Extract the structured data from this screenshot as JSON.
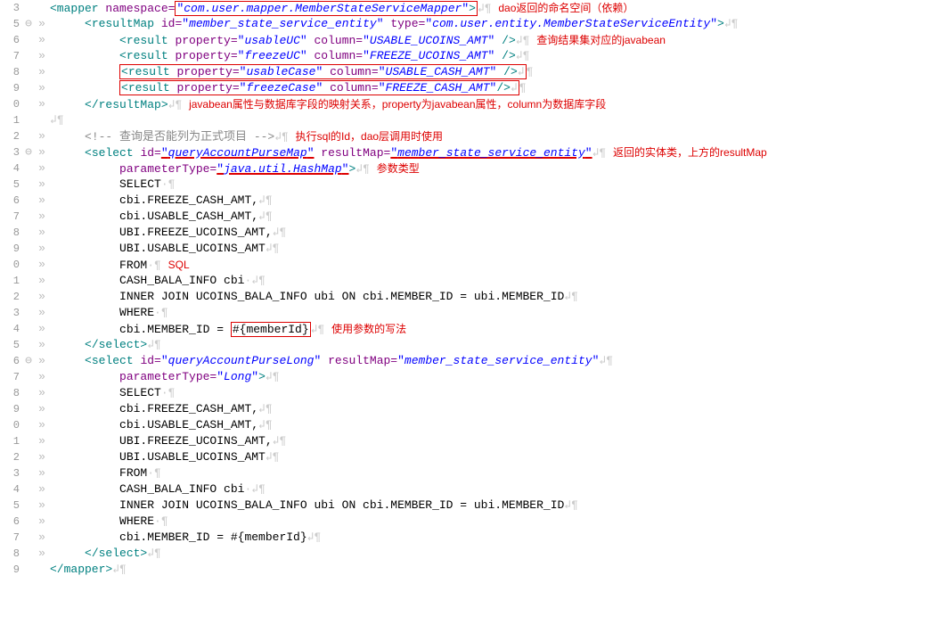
{
  "lines": [
    {
      "n": "3",
      "m": "",
      "g": "",
      "i": 0,
      "tokens": [
        [
          "tag",
          "<mapper "
        ],
        [
          "attr",
          "namespace="
        ],
        [
          "box",
          [
            [
              "valout",
              "\""
            ],
            [
              "val",
              "com.user.mapper.MemberStateServiceMapper"
            ],
            [
              "valout",
              "\""
            ],
            [
              "tag",
              ">"
            ]
          ]
        ],
        [
          "ws",
          "↲¶  "
        ],
        [
          "ann",
          "dao返回的命名空间（依赖）"
        ]
      ]
    },
    {
      "n": "5",
      "m": "⊖",
      "g": "»",
      "i": 1,
      "tokens": [
        [
          "tag",
          "<resultMap "
        ],
        [
          "attr",
          "id="
        ],
        [
          "valout",
          "\""
        ],
        [
          "val",
          "member_state_service_entity"
        ],
        [
          "valout",
          "\" "
        ],
        [
          "attr",
          "type="
        ],
        [
          "valout",
          "\""
        ],
        [
          "val",
          "com.user.entity.MemberStateServiceEntity"
        ],
        [
          "valout",
          "\""
        ],
        [
          "tag",
          ">"
        ],
        [
          "ws",
          "↲¶"
        ]
      ]
    },
    {
      "n": "6",
      "m": "",
      "g": "»",
      "i": 2,
      "tokens": [
        [
          "tag",
          "<result "
        ],
        [
          "attr",
          "property="
        ],
        [
          "valout",
          "\""
        ],
        [
          "val",
          "usableUC"
        ],
        [
          "valout",
          "\" "
        ],
        [
          "attr",
          "column="
        ],
        [
          "valout",
          "\""
        ],
        [
          "val",
          "USABLE_UCOINS_AMT"
        ],
        [
          "valout",
          "\""
        ],
        [
          "tag",
          " />"
        ],
        [
          "ws",
          "↲¶        "
        ],
        [
          "ann",
          "查询结果集对应的javabean"
        ]
      ]
    },
    {
      "n": "7",
      "m": "",
      "g": "»",
      "i": 2,
      "tokens": [
        [
          "tag",
          "<result "
        ],
        [
          "attr",
          "property="
        ],
        [
          "valout",
          "\""
        ],
        [
          "val",
          "freezeUC"
        ],
        [
          "valout",
          "\" "
        ],
        [
          "attr",
          "column="
        ],
        [
          "valout",
          "\""
        ],
        [
          "val",
          "FREEZE_UCOINS_AMT"
        ],
        [
          "valout",
          "\""
        ],
        [
          "tag",
          " />"
        ],
        [
          "ws",
          "↲¶"
        ]
      ]
    },
    {
      "n": "8",
      "m": "",
      "g": "»",
      "i": 2,
      "tokens": [
        [
          "box",
          [
            [
              "tag",
              "<result "
            ],
            [
              "attr",
              "property="
            ],
            [
              "valout",
              "\""
            ],
            [
              "val",
              "usableCase"
            ],
            [
              "valout",
              "\" "
            ],
            [
              "attr",
              "column="
            ],
            [
              "valout",
              "\""
            ],
            [
              "val",
              "USABLE_CASH_AMT"
            ],
            [
              "valout",
              "\""
            ],
            [
              "tag",
              " />"
            ],
            [
              "ws",
              "↲"
            ]
          ]
        ],
        [
          "ws",
          "¶"
        ]
      ]
    },
    {
      "n": "9",
      "m": "",
      "g": "»",
      "i": 2,
      "tokens": [
        [
          "box",
          [
            [
              "tag",
              "<result "
            ],
            [
              "attr",
              "property="
            ],
            [
              "valout",
              "\""
            ],
            [
              "val",
              "freezeCase"
            ],
            [
              "valout",
              "\" "
            ],
            [
              "attr",
              "column="
            ],
            [
              "valout",
              "\""
            ],
            [
              "val",
              "FREEZE_CASH_AMT"
            ],
            [
              "valout",
              "\""
            ],
            [
              "tag",
              "/>"
            ],
            [
              "ws",
              "↲"
            ]
          ]
        ],
        [
          "ws",
          "¶"
        ]
      ]
    },
    {
      "n": "0",
      "m": "",
      "g": "»",
      "i": 1,
      "tokens": [
        [
          "tag",
          "</resultMap>"
        ],
        [
          "ws",
          "↲¶        "
        ],
        [
          "ann",
          "javabean属性与数据库字段的映射关系，property为javabean属性，column为数据库字段"
        ]
      ]
    },
    {
      "n": "1",
      "m": "",
      "g": "",
      "i": 0,
      "tokens": [
        [
          "ws",
          "↲¶"
        ]
      ]
    },
    {
      "n": "2",
      "m": "",
      "g": "»",
      "i": 1,
      "tokens": [
        [
          "cmt",
          "<!-- 查询是否能列为正式项目 -->"
        ],
        [
          "ws",
          "↲¶   "
        ],
        [
          "ann",
          "执行sql的Id，dao层调用时使用"
        ]
      ]
    },
    {
      "n": "3",
      "m": "⊖",
      "g": "»",
      "i": 1,
      "tokens": [
        [
          "tag",
          "<select "
        ],
        [
          "attr",
          "id="
        ],
        [
          "uline",
          [
            [
              "valout",
              "\""
            ],
            [
              "val",
              "queryAccountPurseMap"
            ],
            [
              "valout",
              "\""
            ]
          ]
        ],
        [
          "attr",
          " resultMap="
        ],
        [
          "uline",
          [
            [
              "valout",
              "\""
            ],
            [
              "val",
              "member_state_service_entity"
            ],
            [
              "valout",
              "\""
            ]
          ]
        ],
        [
          "ws",
          "↲¶     "
        ],
        [
          "ann",
          "返回的实体类，上方的resultMap"
        ]
      ]
    },
    {
      "n": "4",
      "m": "",
      "g": "»",
      "i": 2,
      "tokens": [
        [
          "attr",
          "parameterType="
        ],
        [
          "uline",
          [
            [
              "valout",
              "\""
            ],
            [
              "val",
              "java.util.HashMap"
            ],
            [
              "valout",
              "\""
            ]
          ]
        ],
        [
          "tag",
          ">"
        ],
        [
          "ws",
          "↲¶  "
        ],
        [
          "ann",
          "参数类型"
        ]
      ]
    },
    {
      "n": "5",
      "m": "",
      "g": "»",
      "i": 2,
      "tokens": [
        [
          "",
          "SELECT"
        ],
        [
          "ws",
          "·¶"
        ]
      ]
    },
    {
      "n": "6",
      "m": "",
      "g": "»",
      "i": 2,
      "tokens": [
        [
          "",
          "cbi.FREEZE_CASH_AMT,"
        ],
        [
          "ws",
          "↲¶"
        ]
      ]
    },
    {
      "n": "7",
      "m": "",
      "g": "»",
      "i": 2,
      "tokens": [
        [
          "",
          "cbi.USABLE_CASH_AMT,"
        ],
        [
          "ws",
          "↲¶"
        ]
      ]
    },
    {
      "n": "8",
      "m": "",
      "g": "»",
      "i": 2,
      "tokens": [
        [
          "",
          "UBI.FREEZE_UCOINS_AMT,"
        ],
        [
          "ws",
          "↲¶"
        ]
      ]
    },
    {
      "n": "9",
      "m": "",
      "g": "»",
      "i": 2,
      "tokens": [
        [
          "",
          "UBI.USABLE_UCOINS_AMT"
        ],
        [
          "ws",
          "↲¶"
        ]
      ]
    },
    {
      "n": "0",
      "m": "",
      "g": "»",
      "i": 2,
      "tokens": [
        [
          "",
          "FROM"
        ],
        [
          "ws",
          "·¶                           "
        ],
        [
          "ann",
          "SQL"
        ]
      ]
    },
    {
      "n": "1",
      "m": "",
      "g": "»",
      "i": 2,
      "tokens": [
        [
          "",
          "CASH_BALA_INFO cbi"
        ],
        [
          "ws",
          "·↲¶"
        ]
      ]
    },
    {
      "n": "2",
      "m": "",
      "g": "»",
      "i": 2,
      "tokens": [
        [
          "",
          "INNER JOIN UCOINS_BALA_INFO ubi ON cbi.MEMBER_ID = ubi.MEMBER_ID"
        ],
        [
          "ws",
          "↲¶"
        ]
      ]
    },
    {
      "n": "3",
      "m": "",
      "g": "»",
      "i": 2,
      "tokens": [
        [
          "",
          "WHERE"
        ],
        [
          "ws",
          "·¶"
        ]
      ]
    },
    {
      "n": "4",
      "m": "",
      "g": "»",
      "i": 2,
      "tokens": [
        [
          "",
          "cbi.MEMBER_ID = "
        ],
        [
          "box",
          [
            [
              "",
              " #{memberId}"
            ]
          ]
        ],
        [
          "ws",
          "↲¶ "
        ],
        [
          "ann",
          "使用参数的写法"
        ]
      ]
    },
    {
      "n": "5",
      "m": "",
      "g": "»",
      "i": 1,
      "tokens": [
        [
          "tag",
          "</select>"
        ],
        [
          "ws",
          "↲¶"
        ]
      ]
    },
    {
      "n": "6",
      "m": "⊖",
      "g": "»",
      "i": 1,
      "tokens": [
        [
          "tag",
          "<select "
        ],
        [
          "attr",
          "id="
        ],
        [
          "valout",
          "\""
        ],
        [
          "val",
          "queryAccountPurseLong"
        ],
        [
          "valout",
          "\" "
        ],
        [
          "attr",
          "resultMap="
        ],
        [
          "valout",
          "\""
        ],
        [
          "val",
          "member_state_service_entity"
        ],
        [
          "valout",
          "\""
        ],
        [
          "ws",
          "↲¶"
        ]
      ]
    },
    {
      "n": "7",
      "m": "",
      "g": "»",
      "i": 2,
      "tokens": [
        [
          "attr",
          "parameterType="
        ],
        [
          "valout",
          "\""
        ],
        [
          "val",
          "Long"
        ],
        [
          "valout",
          "\""
        ],
        [
          "tag",
          ">"
        ],
        [
          "ws",
          "↲¶"
        ]
      ]
    },
    {
      "n": "8",
      "m": "",
      "g": "»",
      "i": 2,
      "tokens": [
        [
          "",
          "SELECT"
        ],
        [
          "ws",
          "·¶"
        ]
      ]
    },
    {
      "n": "9",
      "m": "",
      "g": "»",
      "i": 2,
      "tokens": [
        [
          "",
          "cbi.FREEZE_CASH_AMT,"
        ],
        [
          "ws",
          "↲¶"
        ]
      ]
    },
    {
      "n": "0",
      "m": "",
      "g": "»",
      "i": 2,
      "tokens": [
        [
          "",
          "cbi.USABLE_CASH_AMT,"
        ],
        [
          "ws",
          "↲¶"
        ]
      ]
    },
    {
      "n": "1",
      "m": "",
      "g": "»",
      "i": 2,
      "tokens": [
        [
          "",
          "UBI.FREEZE_UCOINS_AMT,"
        ],
        [
          "ws",
          "↲¶"
        ]
      ]
    },
    {
      "n": "2",
      "m": "",
      "g": "»",
      "i": 2,
      "tokens": [
        [
          "",
          "UBI.USABLE_UCOINS_AMT"
        ],
        [
          "ws",
          "↲¶"
        ]
      ]
    },
    {
      "n": "3",
      "m": "",
      "g": "»",
      "i": 2,
      "tokens": [
        [
          "",
          "FROM"
        ],
        [
          "ws",
          "·¶"
        ]
      ]
    },
    {
      "n": "4",
      "m": "",
      "g": "»",
      "i": 2,
      "tokens": [
        [
          "",
          "CASH_BALA_INFO cbi"
        ],
        [
          "ws",
          "·↲¶"
        ]
      ]
    },
    {
      "n": "5",
      "m": "",
      "g": "»",
      "i": 2,
      "tokens": [
        [
          "",
          "INNER JOIN UCOINS_BALA_INFO ubi ON cbi.MEMBER_ID = ubi.MEMBER_ID"
        ],
        [
          "ws",
          "↲¶"
        ]
      ]
    },
    {
      "n": "6",
      "m": "",
      "g": "»",
      "i": 2,
      "tokens": [
        [
          "",
          "WHERE"
        ],
        [
          "ws",
          "·¶"
        ]
      ]
    },
    {
      "n": "7",
      "m": "",
      "g": "»",
      "i": 2,
      "tokens": [
        [
          "",
          "cbi.MEMBER_ID = #{memberId}"
        ],
        [
          "ws",
          "↲¶"
        ]
      ]
    },
    {
      "n": "8",
      "m": "",
      "g": "»",
      "i": 1,
      "tokens": [
        [
          "tag",
          "</select>"
        ],
        [
          "ws",
          "↲¶"
        ]
      ]
    },
    {
      "n": "9",
      "m": "",
      "g": "",
      "i": 0,
      "tokens": [
        [
          "tag",
          "</mapper>"
        ],
        [
          "ws",
          "↲¶"
        ]
      ]
    }
  ]
}
